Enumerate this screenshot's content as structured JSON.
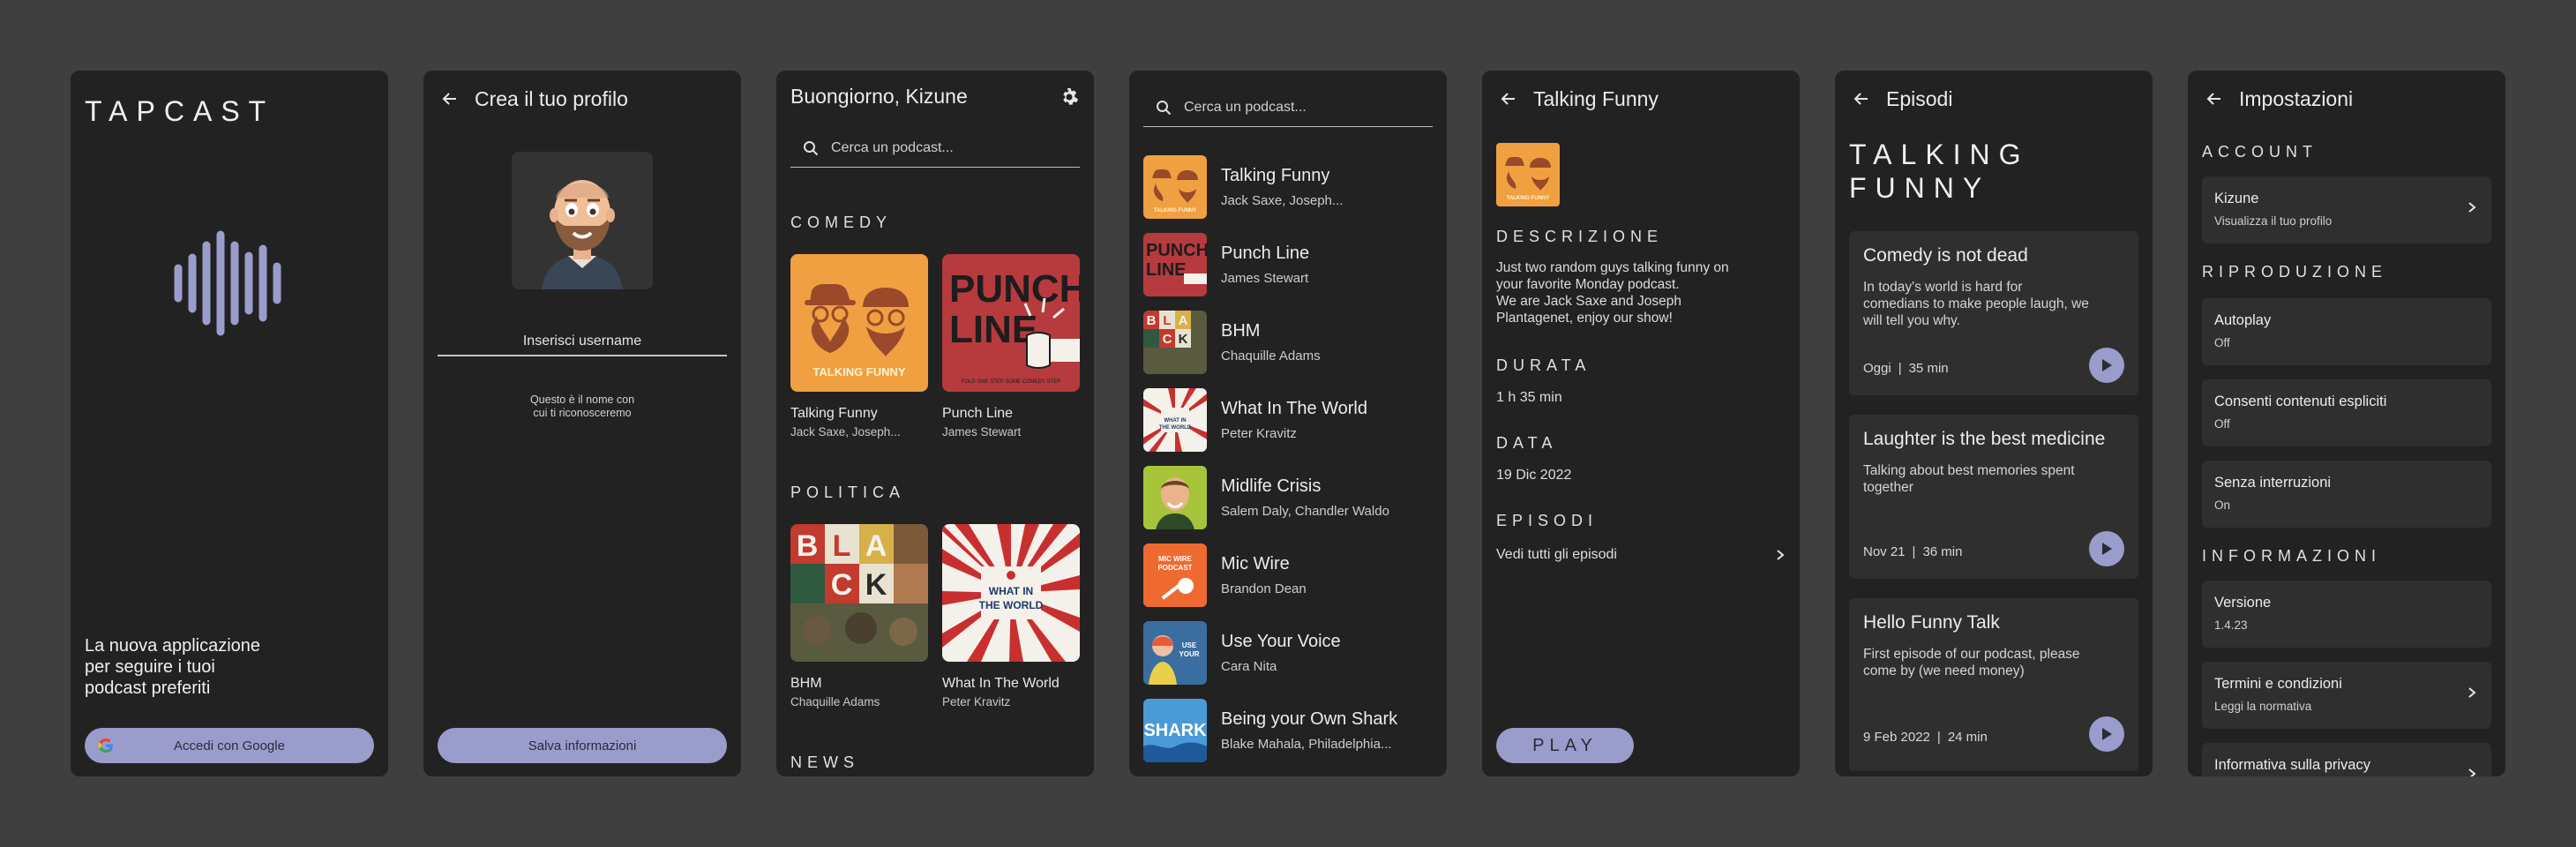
{
  "accent": "#9a9ccc",
  "screen1": {
    "brand": "TAPCAST",
    "tagline_lines": [
      "La nuova applicazione",
      "per seguire i tuoi",
      "podcast preferiti"
    ],
    "google_button": "Accedi con Google",
    "wave_icon": "audio-wave-icon"
  },
  "screen2": {
    "title": "Crea il tuo profilo",
    "username_placeholder": "Inserisci username",
    "hint_lines": [
      "Questo è il nome con",
      "cui ti riconosceremo"
    ],
    "save_button": "Salva informazioni"
  },
  "screen3": {
    "greeting": "Buongiorno, Kizune",
    "search_placeholder": "Cerca un podcast...",
    "sections": [
      {
        "name": "COMEDY",
        "items": [
          {
            "title": "Talking Funny",
            "authors": "Jack Saxe, Joseph..."
          },
          {
            "title": "Punch Line",
            "authors": "James Stewart"
          }
        ]
      },
      {
        "name": "POLITICA",
        "items": [
          {
            "title": "BHM",
            "authors": "Chaquille Adams"
          },
          {
            "title": "What In The World",
            "authors": "Peter Kravitz"
          }
        ]
      },
      {
        "name": "NEWS",
        "items": []
      }
    ]
  },
  "screen4": {
    "search_placeholder": "Cerca un podcast...",
    "results": [
      {
        "title": "Talking Funny",
        "authors": "Jack Saxe, Joseph..."
      },
      {
        "title": "Punch Line",
        "authors": "James Stewart"
      },
      {
        "title": "BHM",
        "authors": "Chaquille Adams"
      },
      {
        "title": "What In The World",
        "authors": "Peter Kravitz"
      },
      {
        "title": "Midlife Crisis",
        "authors": "Salem Daly, Chandler Waldo"
      },
      {
        "title": "Mic Wire",
        "authors": "Brandon Dean"
      },
      {
        "title": "Use Your Voice",
        "authors": "Cara Nita"
      },
      {
        "title": "Being your Own Shark",
        "authors": "Blake Mahala, Philadelphia..."
      }
    ]
  },
  "screen5": {
    "title": "Talking Funny",
    "desc_label": "DESCRIZIONE",
    "desc_lines": [
      "Just two random guys talking funny on",
      "your favorite Monday podcast.",
      "We are Jack Saxe and Joseph",
      "Plantagenet, enjoy our show!"
    ],
    "duration_label": "DURATA",
    "duration": "1 h 35 min",
    "date_label": "DATA",
    "date": "19 Dic 2022",
    "episodes_label": "EPISODI",
    "all_episodes": "Vedi tutti gli episodi",
    "play_button": "PLAY"
  },
  "screen6": {
    "title": "Episodi",
    "podcast_title_lines": [
      "TALKING",
      "FUNNY"
    ],
    "episodes": [
      {
        "title": "Comedy is not dead",
        "desc_lines": [
          "In today's world is hard for",
          "comedians to make people laugh, we",
          "will tell you why."
        ],
        "date": "Oggi",
        "length": "35 min"
      },
      {
        "title": "Laughter is the best medicine",
        "desc_lines": [
          "Talking about best memories spent",
          "together"
        ],
        "date": "Nov 21",
        "length": "36 min"
      },
      {
        "title": "Hello Funny Talk",
        "desc_lines": [
          "First episode of our podcast, please",
          "come by (we need money)"
        ],
        "date": "9 Feb 2022",
        "length": "24 min"
      }
    ]
  },
  "screen7": {
    "title": "Impostazioni",
    "sections": {
      "account": "ACCOUNT",
      "playback": "RIPRODUZIONE",
      "info": "INFORMAZIONI"
    },
    "account_name": "Kizune",
    "account_sub": "Visualizza il tuo profilo",
    "autoplay": "Autoplay",
    "autoplay_val": "Off",
    "explicit": "Consenti contenuti espliciti",
    "explicit_val": "Off",
    "uninterrupted": "Senza interruzioni",
    "uninterrupted_val": "On",
    "version": "Versione",
    "version_val": "1.4.23",
    "terms": "Termini e condizioni",
    "terms_sub": "Leggi la normativa",
    "privacy": "Informativa sulla privacy"
  }
}
